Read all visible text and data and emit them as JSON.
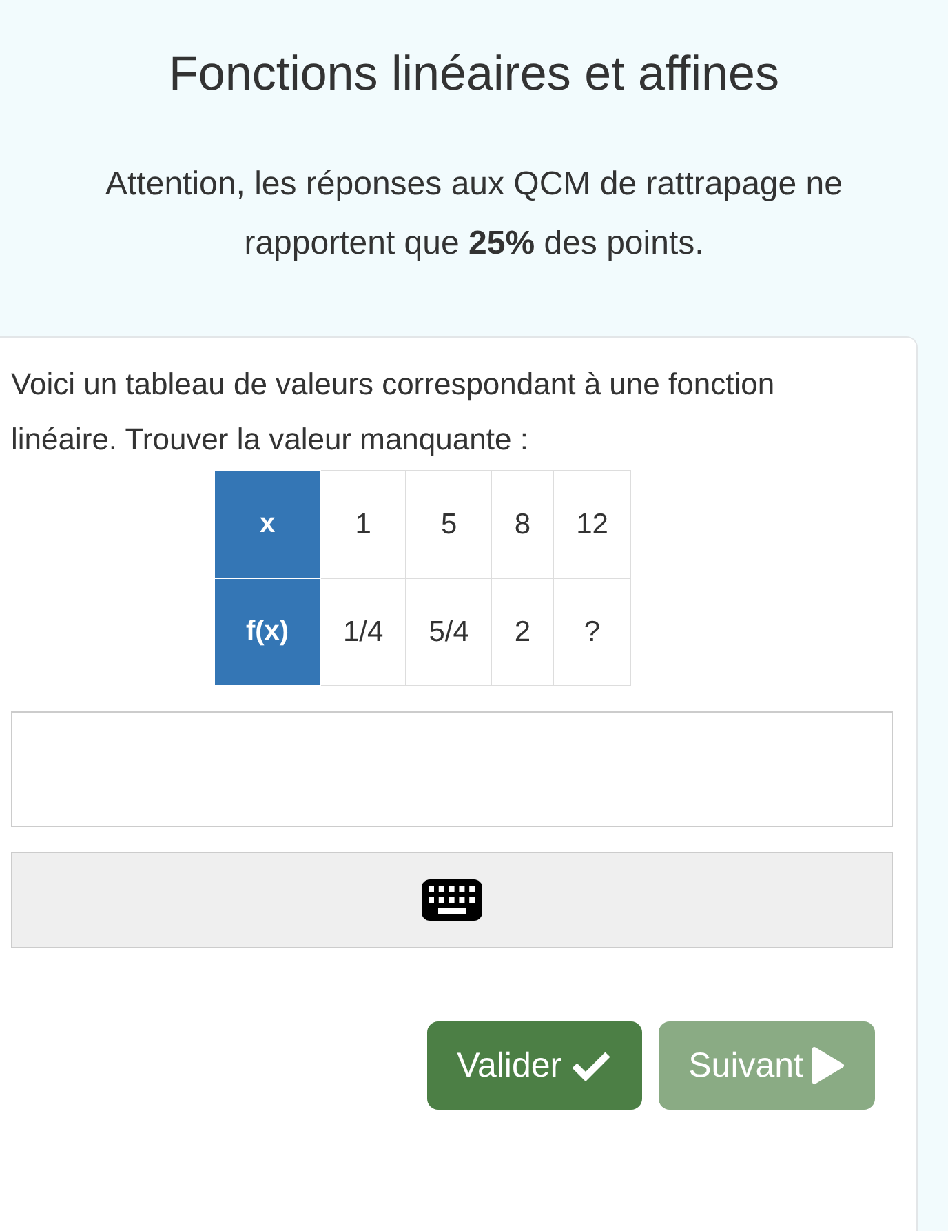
{
  "header": {
    "title": "Fonctions linéaires et affines",
    "notice": "Attention, les réponses aux QCM de rattrapage ne rapportent que **25%** des points."
  },
  "question": {
    "text": "Voici un tableau de valeurs correspondant à une fonction linéaire. Trouver la valeur manquante :",
    "table": {
      "rows": [
        {
          "header": "x",
          "cells": [
            "1",
            "5",
            "8",
            "12"
          ]
        },
        {
          "header": "f(x)",
          "cells": [
            "1/4",
            "5/4",
            "2",
            "?"
          ]
        }
      ]
    },
    "buttons": [
      {
        "kind": "validate",
        "label": "Valider",
        "disabled": false
      },
      {
        "kind": "next",
        "label": "Suivant",
        "disabled": true
      }
    ]
  }
}
